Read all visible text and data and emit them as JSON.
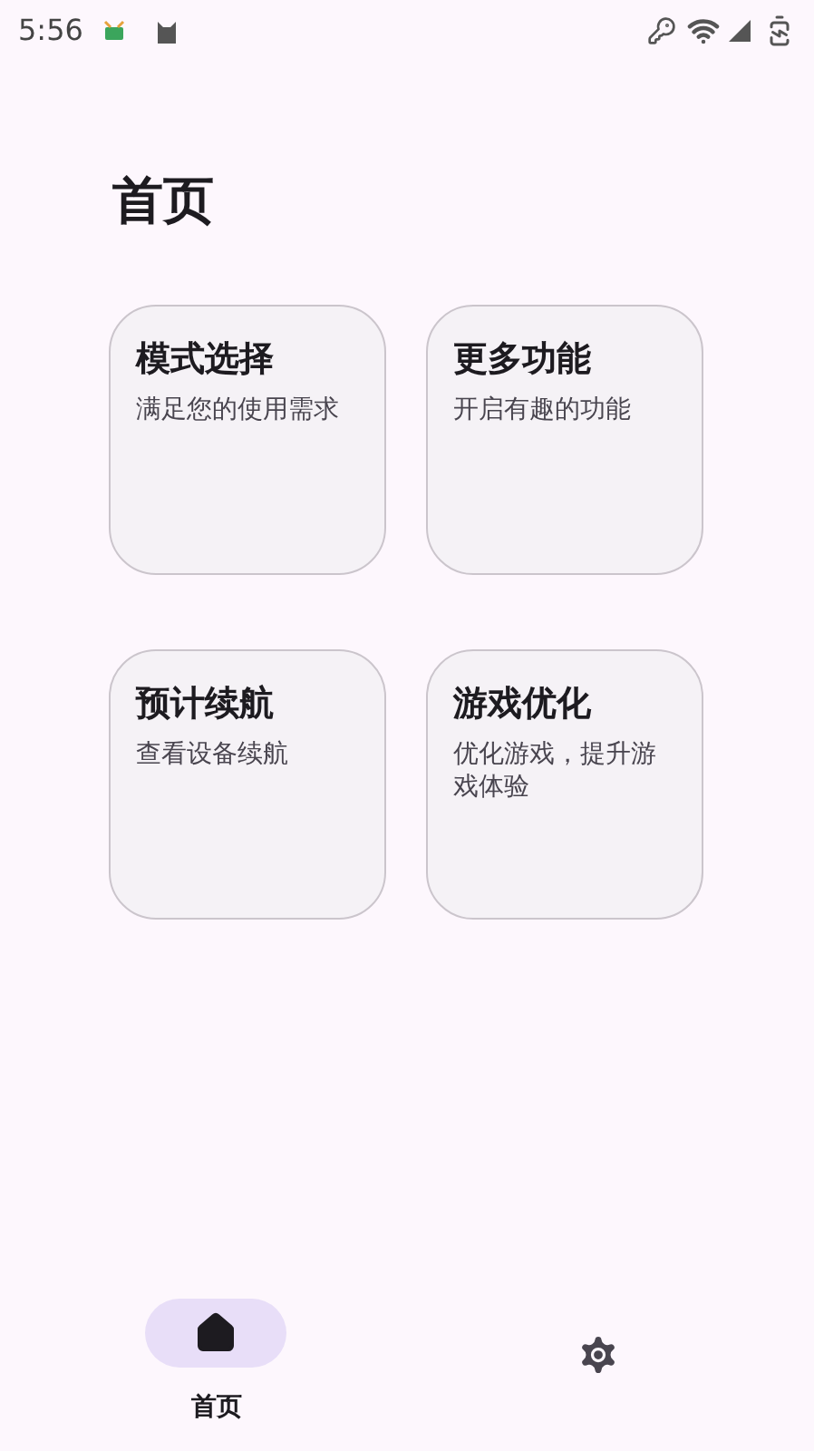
{
  "status_bar": {
    "time": "5:56"
  },
  "title": "首页",
  "cards": [
    {
      "title": "模式选择",
      "subtitle": "满足您的使用需求"
    },
    {
      "title": "更多功能",
      "subtitle": "开启有趣的功能"
    },
    {
      "title": "预计续航",
      "subtitle": "查看设备续航"
    },
    {
      "title": "游戏优化",
      "subtitle": "优化游戏，提升游戏体验"
    }
  ],
  "nav": [
    {
      "kind": "home",
      "label": "首页",
      "selected": true
    },
    {
      "kind": "settings",
      "selected": false
    }
  ]
}
